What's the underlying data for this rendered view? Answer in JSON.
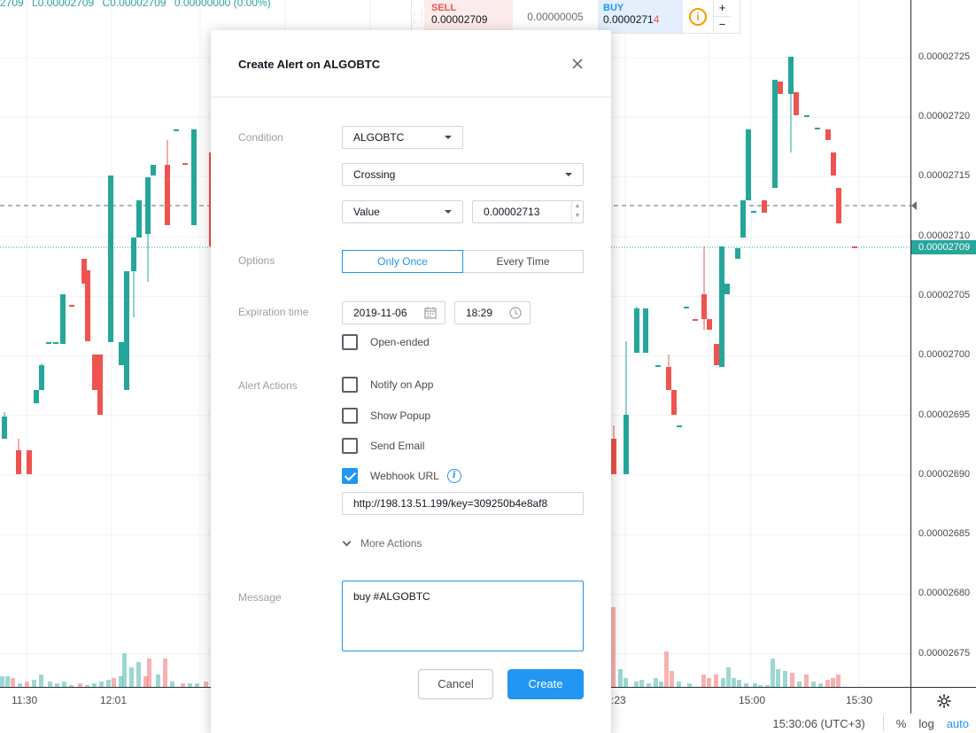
{
  "chart": {
    "ohlc_text": [
      "2709",
      "L0.00002709",
      "C0.00002709",
      "0.00000000 (0.00%)"
    ],
    "up_color": "#26a69a",
    "down_color": "#ef5350",
    "price_labels": [
      "0.00002725",
      "0.00002720",
      "0.00002715",
      "0.00002710",
      "0.00002705",
      "0.00002700",
      "0.00002695",
      "0.00002690",
      "0.00002685",
      "0.00002680",
      "0.00002675"
    ],
    "current_price_tag": "0.00002709",
    "time_labels": [
      "11:30",
      "12:01",
      ":23",
      "15:00",
      "15:30"
    ]
  },
  "trade_widget": {
    "sell_label": "SELL",
    "sell_price": "0.00002709",
    "spread": "0.00000005",
    "buy_label": "BUY",
    "buy_price_main": "0.0000271",
    "buy_price_hi": "4",
    "info_icon": "i",
    "plus": "+",
    "minus": "−"
  },
  "dialog": {
    "title": "Create Alert on ALGOBTC",
    "condition_label": "Condition",
    "symbol_select": "ALGOBTC",
    "crossing_select": "Crossing",
    "value_select": "Value",
    "value_input": "0.00002713",
    "options_label": "Options",
    "only_once": "Only Once",
    "every_time": "Every Time",
    "expiration_label": "Expiration time",
    "exp_date": "2019-11-06",
    "exp_time": "18:29",
    "open_ended": "Open-ended",
    "alert_actions_label": "Alert Actions",
    "notify_app": "Notify on App",
    "show_popup": "Show Popup",
    "send_email": "Send Email",
    "webhook_url": "Webhook URL",
    "webhook_value": "http://198.13.51.199/key=309250b4e8af8",
    "more_actions": "More Actions",
    "message_label": "Message",
    "message_text": "buy #ALGOBTC",
    "cancel": "Cancel",
    "create": "Create"
  },
  "status_bar": {
    "clock": "15:30:06 (UTC+3)",
    "percent": "%",
    "log": "log",
    "auto": "auto"
  }
}
